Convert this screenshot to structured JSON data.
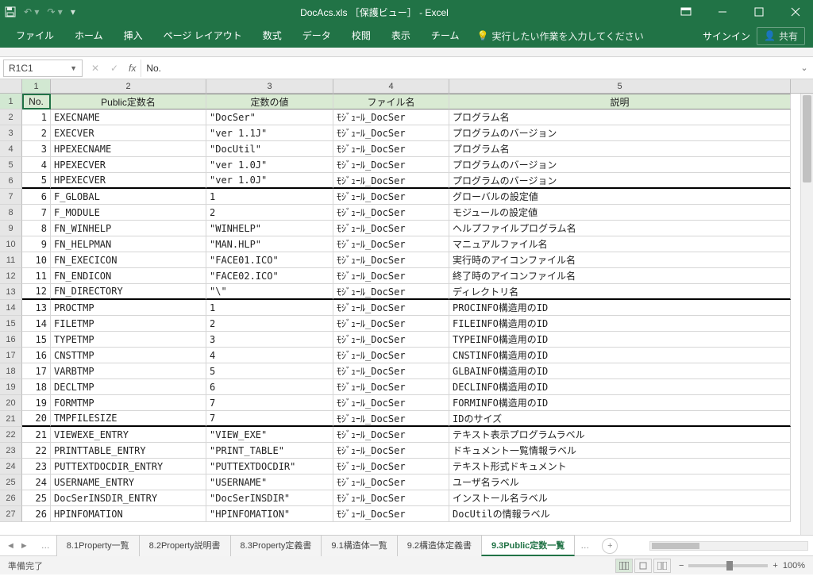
{
  "window": {
    "title": "DocAcs.xls ［保護ビュー］ - Excel",
    "signin": "サインイン",
    "share": "共有"
  },
  "ribbon_tabs": [
    "ファイル",
    "ホーム",
    "挿入",
    "ページ レイアウト",
    "数式",
    "データ",
    "校閲",
    "表示",
    "チーム"
  ],
  "tell_me": "実行したい作業を入力してください",
  "namebox": "R1C1",
  "formula": "No.",
  "col_headers": [
    "1",
    "2",
    "3",
    "4",
    "5"
  ],
  "table_headers": [
    "No.",
    "Public定数名",
    "定数の値",
    "ファイル名",
    "説明"
  ],
  "rows": [
    {
      "n": 1,
      "name": "EXECNAME",
      "val": "\"DocSer\"",
      "file": "ﾓｼﾞｭｰﾙ_DocSer",
      "desc": "プログラム名"
    },
    {
      "n": 2,
      "name": "EXECVER",
      "val": "\"ver 1.1J\"",
      "file": "ﾓｼﾞｭｰﾙ_DocSer",
      "desc": "プログラムのバージョン"
    },
    {
      "n": 3,
      "name": "HPEXECNAME",
      "val": "\"DocUtil\"",
      "file": "ﾓｼﾞｭｰﾙ_DocSer",
      "desc": "プログラム名"
    },
    {
      "n": 4,
      "name": "HPEXECVER",
      "val": "\"ver 1.0J\"",
      "file": "ﾓｼﾞｭｰﾙ_DocSer",
      "desc": "プログラムのバージョン"
    },
    {
      "n": 5,
      "name": "HPEXECVER",
      "val": "\"ver 1.0J\"",
      "file": "ﾓｼﾞｭｰﾙ_DocSer",
      "desc": "プログラムのバージョン"
    },
    {
      "n": 6,
      "name": "F_GLOBAL",
      "val": "1",
      "file": "ﾓｼﾞｭｰﾙ_DocSer",
      "desc": "グローバルの設定値"
    },
    {
      "n": 7,
      "name": "F_MODULE",
      "val": "2",
      "file": "ﾓｼﾞｭｰﾙ_DocSer",
      "desc": "モジュールの設定値"
    },
    {
      "n": 8,
      "name": "FN_WINHELP",
      "val": "\"WINHELP\"",
      "file": "ﾓｼﾞｭｰﾙ_DocSer",
      "desc": "ヘルプファイルプログラム名"
    },
    {
      "n": 9,
      "name": "FN_HELPMAN",
      "val": "\"MAN.HLP\"",
      "file": "ﾓｼﾞｭｰﾙ_DocSer",
      "desc": "マニュアルファイル名"
    },
    {
      "n": 10,
      "name": "FN_EXECICON",
      "val": "\"FACE01.ICO\"",
      "file": "ﾓｼﾞｭｰﾙ_DocSer",
      "desc": "実行時のアイコンファイル名"
    },
    {
      "n": 11,
      "name": "FN_ENDICON",
      "val": "\"FACE02.ICO\"",
      "file": "ﾓｼﾞｭｰﾙ_DocSer",
      "desc": "終了時のアイコンファイル名"
    },
    {
      "n": 12,
      "name": "FN_DIRECTORY",
      "val": "\"\\\"",
      "file": "ﾓｼﾞｭｰﾙ_DocSer",
      "desc": "ディレクトリ名"
    },
    {
      "n": 13,
      "name": "PROCTMP",
      "val": "1",
      "file": "ﾓｼﾞｭｰﾙ_DocSer",
      "desc": "PROCINFO構造用のID"
    },
    {
      "n": 14,
      "name": "FILETMP",
      "val": "2",
      "file": "ﾓｼﾞｭｰﾙ_DocSer",
      "desc": "FILEINFO構造用のID"
    },
    {
      "n": 15,
      "name": "TYPETMP",
      "val": "3",
      "file": "ﾓｼﾞｭｰﾙ_DocSer",
      "desc": "TYPEINFO構造用のID"
    },
    {
      "n": 16,
      "name": "CNSTTMP",
      "val": "4",
      "file": "ﾓｼﾞｭｰﾙ_DocSer",
      "desc": "CNSTINFO構造用のID"
    },
    {
      "n": 17,
      "name": "VARBTMP",
      "val": "5",
      "file": "ﾓｼﾞｭｰﾙ_DocSer",
      "desc": "GLBAINFO構造用のID"
    },
    {
      "n": 18,
      "name": "DECLTMP",
      "val": "6",
      "file": "ﾓｼﾞｭｰﾙ_DocSer",
      "desc": "DECLINFO構造用のID"
    },
    {
      "n": 19,
      "name": "FORMTMP",
      "val": "7",
      "file": "ﾓｼﾞｭｰﾙ_DocSer",
      "desc": "FORMINFO構造用のID"
    },
    {
      "n": 20,
      "name": "TMPFILESIZE",
      "val": "7",
      "file": "ﾓｼﾞｭｰﾙ_DocSer",
      "desc": "IDのサイズ"
    },
    {
      "n": 21,
      "name": "VIEWEXE_ENTRY",
      "val": "\"VIEW_EXE\"",
      "file": "ﾓｼﾞｭｰﾙ_DocSer",
      "desc": "テキスト表示プログラムラベル"
    },
    {
      "n": 22,
      "name": "PRINTTABLE_ENTRY",
      "val": "\"PRINT_TABLE\"",
      "file": "ﾓｼﾞｭｰﾙ_DocSer",
      "desc": "ドキュメント一覧情報ラベル"
    },
    {
      "n": 23,
      "name": "PUTTEXTDOCDIR_ENTRY",
      "val": "\"PUTTEXTDOCDIR\"",
      "file": "ﾓｼﾞｭｰﾙ_DocSer",
      "desc": "テキスト形式ドキュメント"
    },
    {
      "n": 24,
      "name": "USERNAME_ENTRY",
      "val": "\"USERNAME\"",
      "file": "ﾓｼﾞｭｰﾙ_DocSer",
      "desc": "ユーザ名ラベル"
    },
    {
      "n": 25,
      "name": "DocSerINSDIR_ENTRY",
      "val": "\"DocSerINSDIR\"",
      "file": "ﾓｼﾞｭｰﾙ_DocSer",
      "desc": "インストール名ラベル"
    },
    {
      "n": 26,
      "name": "HPINFOMATION",
      "val": "\"HPINFOMATION\"",
      "file": "ﾓｼﾞｭｰﾙ_DocSer",
      "desc": "DocUtilの情報ラベル"
    }
  ],
  "sheet_tabs": {
    "list": [
      "8.1Property一覧",
      "8.2Property説明書",
      "8.3Property定義書",
      "9.1構造体一覧",
      "9.2構造体定義書",
      "9.3Public定数一覧"
    ],
    "active": 5
  },
  "status": {
    "ready": "準備完了",
    "zoom": "100%"
  }
}
